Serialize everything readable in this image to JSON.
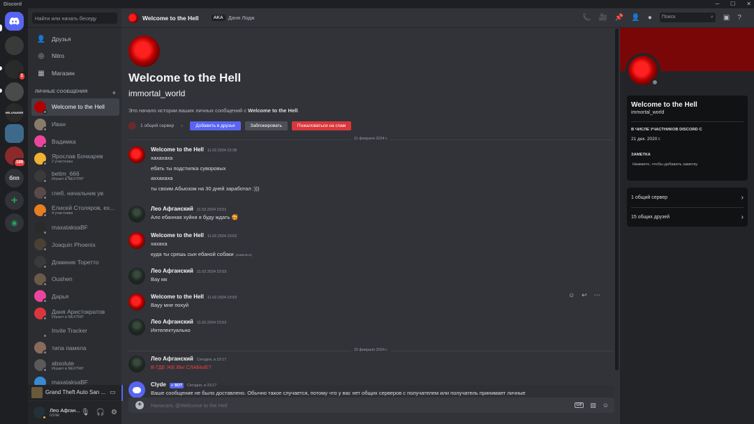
{
  "app": {
    "title": "Discord"
  },
  "dm_sidebar": {
    "search_placeholder": "Найти или начать беседу",
    "nav": [
      {
        "label": "Друзья",
        "icon": "friends-icon"
      },
      {
        "label": "Nitro",
        "icon": "nitro-icon"
      },
      {
        "label": "Магазин",
        "icon": "shop-icon"
      }
    ],
    "dm_header": "Личные сообщения",
    "dms": [
      {
        "name": "Welcome to the Hell",
        "sub": "",
        "color": "#b30000"
      },
      {
        "name": "Иван",
        "sub": "",
        "color": "#8a7a6a"
      },
      {
        "name": "Вадимка",
        "sub": "",
        "color": "#eb459e"
      },
      {
        "name": "Ярослав Бочкарев",
        "sub": "2 участника",
        "color": "#f0b232"
      },
      {
        "name": "betim_666",
        "sub": "Играет в NEXTRP",
        "color": "#3a3a3a"
      },
      {
        "name": "глеб. начальник ув",
        "sub": "",
        "color": "#5a4a4a"
      },
      {
        "name": "Елисей Столяров, ex...",
        "sub": "4 участника",
        "color": "#e67e22"
      },
      {
        "name": "maxataksaBF",
        "sub": "",
        "color": "#2a2a2a"
      },
      {
        "name": "Joaquin Phoenix",
        "sub": "",
        "color": "#4a4036"
      },
      {
        "name": "Доминик Торетто",
        "sub": "",
        "color": "#3a3a3a"
      },
      {
        "name": "Oushen",
        "sub": "",
        "color": "#6a5a4a"
      },
      {
        "name": "Дарья",
        "sub": "",
        "color": "#eb459e"
      },
      {
        "name": "Даня Аристократов",
        "sub": "Играет в NEXTRP",
        "color": "#da373c"
      },
      {
        "name": "Invite Tracker",
        "sub": "",
        "color": "#2b2d31"
      },
      {
        "name": "типа памела",
        "sub": "",
        "color": "#8a6a5a"
      },
      {
        "name": "absolute",
        "sub": "Играет в NEXTRP",
        "color": "#5a5a5a"
      },
      {
        "name": "maxataksaBF",
        "sub": "",
        "color": "#3a8ad2"
      }
    ],
    "game_title": "Grand Theft Auto San ...",
    "user": {
      "name": "Лео Афган...",
      "status": "сплю"
    }
  },
  "servers": [
    {
      "label": "",
      "color": "#3a3a3a",
      "badge": ""
    },
    {
      "label": "",
      "color": "#2a2a2a",
      "badge": "1"
    },
    {
      "label": "",
      "color": "#4a4a4a",
      "badge": ""
    },
    {
      "label": "HELLRAISER",
      "color": "#2a2a2a",
      "badge": ""
    },
    {
      "label": "",
      "color": "#3d6a8a",
      "badge": ""
    },
    {
      "label": "",
      "color": "#8a2a2a",
      "badge": "189"
    },
    {
      "label": "бпп",
      "color": "#313338",
      "badge": ""
    }
  ],
  "header": {
    "title": "Welcome to the Hell",
    "aka_label": "AKA",
    "aka_name": "Даня Лодж",
    "search_placeholder": "Поиск"
  },
  "intro": {
    "title": "Welcome to the Hell",
    "username": "immortal_world",
    "desc_prefix": "Это начало истории ваших личных сообщений с",
    "desc_name": "Welcome to the Hell",
    "desc_suffix": ".",
    "mutual": "1 общий сервер",
    "add_friend": "Добавить в друзья",
    "block": "Заблокировать",
    "report": "Пожаловаться на спам"
  },
  "dividers": [
    "11 февраля 2024 г.",
    "15 февраля 2024 г."
  ],
  "messages": [
    {
      "author": "Welcome to the Hell",
      "time": "11.02.2024 22:38",
      "av": "hell",
      "lines": [
        "хахахаха",
        "ебать ты подстилка суворовых",
        "аххахаха",
        "ты своим Абьюзом на 30 дней заработал :)))"
      ]
    },
    {
      "author": "Лео Афганский",
      "time": "11.02.2024 23:51",
      "av": "leo",
      "lines": [
        "Ало ебанная хуйня я буду ждать 🥰"
      ]
    },
    {
      "author": "Welcome to the Hell",
      "time": "11.02.2024 23:52",
      "av": "hell",
      "lines": [
        "хахаха",
        "куда ты срешь сын ебаной собаки"
      ],
      "edited": "(изменено)"
    },
    {
      "author": "Лео Афганский",
      "time": "11.02.2024 23:53",
      "av": "leo",
      "lines": [
        "Вау мк"
      ]
    },
    {
      "author": "Welcome to the Hell",
      "time": "11.02.2024 23:53",
      "av": "hell",
      "lines": [
        "Вауу мне похуй"
      ]
    },
    {
      "author": "Лео Афганский",
      "time": "11.02.2024 23:53",
      "av": "leo",
      "lines": [
        "Интелектуально"
      ]
    },
    {
      "author": "Лео Афганский",
      "time": "Сегодня, в 23:17",
      "av": "leo",
      "lines": [
        "В ГДЕ ЖЕ ВЫ СЛАБЫЕ?"
      ]
    },
    {
      "author": "Clyde",
      "time": "Сегодня, в 23:17",
      "av": "clyde",
      "bot": "✔ BOT",
      "lines": [
        "Ваше сообщение не было доставлено. Обычно такое случается, потому что у вас нет общих серверов с получателем или получатель принимает личные"
      ]
    }
  ],
  "composer": {
    "placeholder": "Написать @Welcome to the Hell",
    "gif": "GIF"
  },
  "profile": {
    "name": "Welcome to the Hell",
    "username": "immortal_world",
    "member_since_label": "В числе участников Discord с",
    "member_since": "21 дек. 2020 г.",
    "note_label": "Заметка",
    "note_placeholder": "Нажмите, чтобы добавить заметку",
    "mutual_servers": "1 общий сервер",
    "mutual_friends": "15 общих друзей"
  }
}
